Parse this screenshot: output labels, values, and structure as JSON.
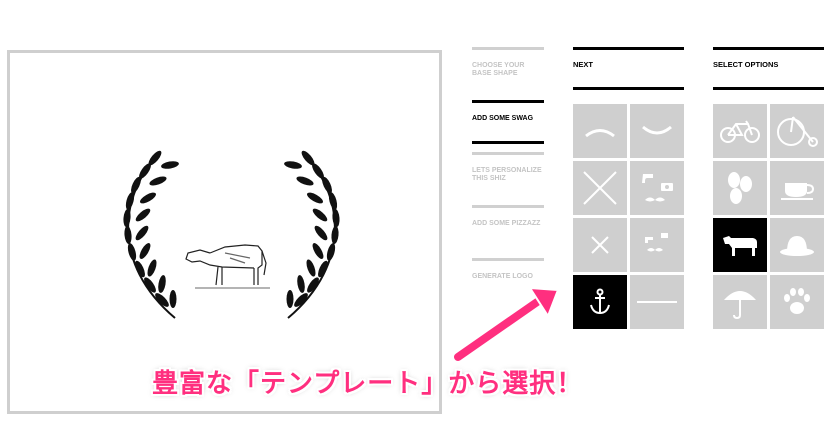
{
  "steps": [
    {
      "label": "CHOOSE YOUR BASE SHAPE",
      "state": "done"
    },
    {
      "label": "ADD SOME SWAG",
      "state": "active"
    },
    {
      "label": "LETS PERSONALIZE THIS SHIZ",
      "state": "todo"
    },
    {
      "label": "ADD SOME PIZZAZZ",
      "state": "todo"
    },
    {
      "label": "GENERATE LOGO",
      "state": "todo"
    }
  ],
  "next_panel": {
    "title": "NEXT",
    "tiles": [
      "arc-up-icon",
      "arc-smile-icon",
      "big-x-icon",
      "pipe-mustache-camera-icon",
      "small-x-icon",
      "pipe-mustache-icon",
      "anchor-icon",
      "line-icon"
    ],
    "selected": "anchor-icon"
  },
  "options_panel": {
    "title": "SELECT OPTIONS",
    "tiles": [
      "bicycle-icon",
      "penny-farthing-icon",
      "coffee-beans-icon",
      "coffee-cup-icon",
      "cow-icon",
      "bowler-hat-icon",
      "umbrella-icon",
      "paw-icon"
    ],
    "selected": "cow-icon"
  },
  "caption": "豊富な「テンプレート」から選択！",
  "colors": {
    "accent": "#ff2f7f",
    "tile": "#cfcfcf",
    "selected": "#000000"
  }
}
